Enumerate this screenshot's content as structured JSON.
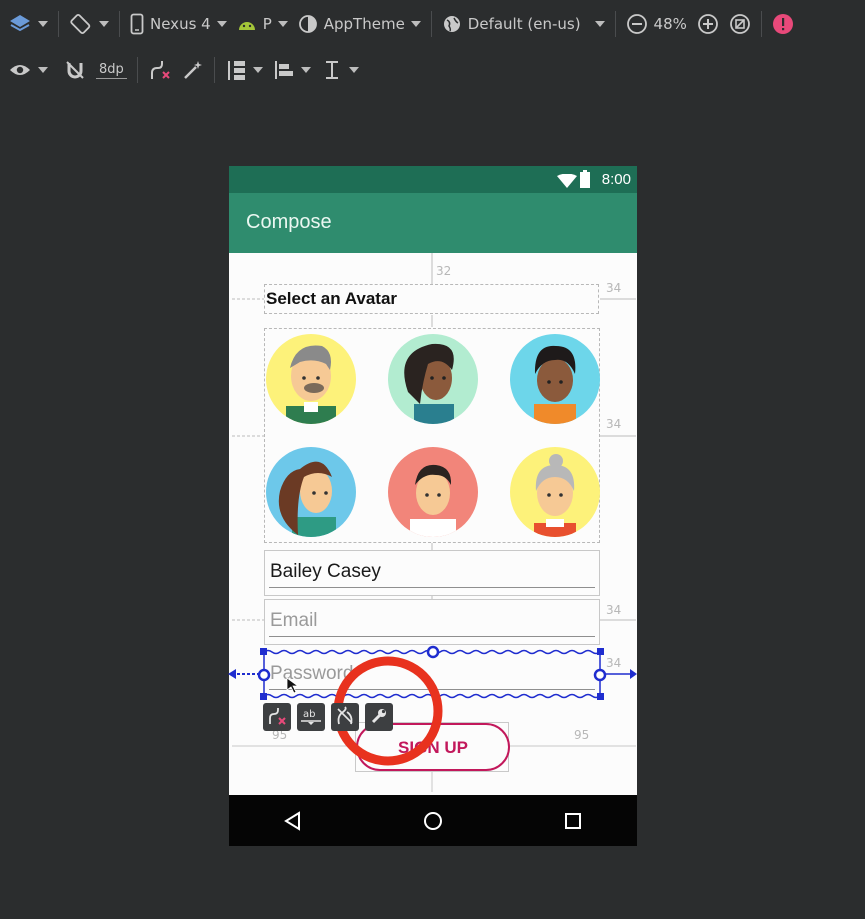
{
  "toolbar": {
    "device": "Nexus 4",
    "api": "P",
    "theme": "AppTheme",
    "locale": "Default (en-us)",
    "zoom": "48%",
    "margin": "8dp"
  },
  "phone": {
    "time": "8:00",
    "app_title": "Compose",
    "heading": "Select an Avatar",
    "name_value": "Bailey Casey",
    "email_placeholder": "Email",
    "password_placeholder": "Password",
    "signup_label": "SIGN UP"
  },
  "dimensions": {
    "top": "32",
    "right1": "34",
    "right2": "34",
    "right3": "34",
    "right4": "34",
    "left_btn": "95",
    "right_btn": "95"
  },
  "colors": {
    "status_bar": "#1e6e55",
    "app_bar": "#2f8c6e",
    "accent": "#c2185b",
    "annotation_circle": "#e8321e",
    "selection": "#1f2dcf",
    "error_badge": "#e8497a"
  },
  "mini_tools": [
    "constraint-delete-icon",
    "baseline-icon",
    "clear-constraints-icon",
    "wrench-icon"
  ]
}
